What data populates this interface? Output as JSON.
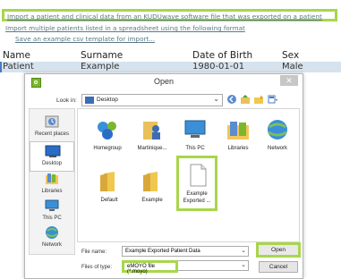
{
  "links": {
    "import_file": "Import a patient and clinical data from an KUDUwave software file that was exported on a patient",
    "import_multiple": "Import multiple patients listed in a spreadsheet using the following format",
    "save_example": "Save an example csv template for import..."
  },
  "table": {
    "headers": [
      "Name",
      "Surname",
      "Date of Birth",
      "Sex"
    ],
    "rows": [
      [
        "Patient",
        "Example",
        "1980-01-01",
        "Male"
      ]
    ]
  },
  "dialog": {
    "title": "Open",
    "close": "✕",
    "look_in_label": "Look in:",
    "look_in_value": "Desktop",
    "places": [
      "Recent places",
      "Desktop",
      "Libraries",
      "This PC",
      "Network"
    ],
    "items": [
      {
        "label": "Homegroup",
        "icon": "homegroup-icon"
      },
      {
        "label": "Martinique...",
        "icon": "user-folder-icon"
      },
      {
        "label": "This PC",
        "icon": "computer-icon"
      },
      {
        "label": "Libraries",
        "icon": "libraries-icon"
      },
      {
        "label": "Network",
        "icon": "network-icon"
      },
      {
        "label": "Default",
        "icon": "folder-icon"
      },
      {
        "label": "Example",
        "icon": "folder-icon"
      },
      {
        "label": "Example Exported ...",
        "icon": "file-icon"
      }
    ],
    "file_name_label": "File name:",
    "file_name_value": "Example Exported Patient Data",
    "file_type_label": "Files of type:",
    "file_type_value": "eMOYO file (*.moyo)",
    "open_label": "Open",
    "cancel_label": "Cancel"
  },
  "colors": {
    "highlight": "#a8d64b",
    "link": "#5a7a86",
    "selected_row": "#d6e3ee"
  }
}
